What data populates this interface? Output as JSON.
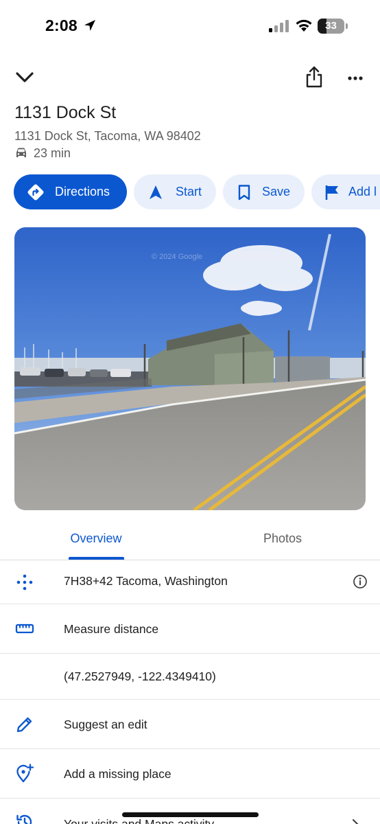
{
  "status_bar": {
    "time": "2:08",
    "battery_percent": "33",
    "battery_level": 0.33
  },
  "place": {
    "title": "1131 Dock St",
    "address": "1131 Dock St, Tacoma, WA 98402",
    "travel_mode_icon": "car-icon",
    "travel_time": "23 min"
  },
  "actions": [
    {
      "label": "Directions",
      "icon": "directions-icon"
    },
    {
      "label": "Start",
      "icon": "navigation-arrow-icon"
    },
    {
      "label": "Save",
      "icon": "bookmark-icon"
    },
    {
      "label": "Add l",
      "icon": "flag-icon"
    }
  ],
  "photo": {
    "watermark": "© 2024 Google"
  },
  "tabs": [
    {
      "label": "Overview",
      "active": true
    },
    {
      "label": "Photos",
      "active": false
    }
  ],
  "rows": {
    "plus_code": "7H38+42 Tacoma, Washington",
    "measure": "Measure distance",
    "coordinates": "(47.2527949, -122.4349410)",
    "suggest": "Suggest an edit",
    "missing": "Add a missing place",
    "visits": "Your visits and Maps activity"
  },
  "colors": {
    "accent": "#0b57d0",
    "chip_background": "#e9f0fb",
    "secondary_text": "#5e5e5e"
  }
}
